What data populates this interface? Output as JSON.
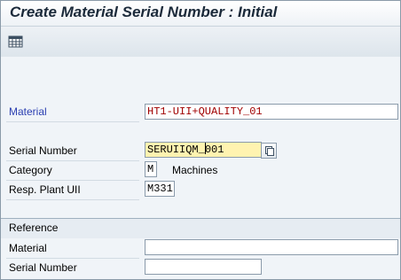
{
  "window": {
    "title": "Create Material Serial Number : Initial"
  },
  "toolbar": {
    "icons": [
      {
        "name": "grid-icon"
      }
    ]
  },
  "form": {
    "material": {
      "label": "Material",
      "value": "HT1-UII+QUALITY_01",
      "required": true
    },
    "serial_number": {
      "label": "Serial Number",
      "value_before_caret": "SERUIIQM_",
      "value_after_caret": "001"
    },
    "category": {
      "label": "Category",
      "value": "M",
      "description": "Machines"
    },
    "resp_plant_uii": {
      "label": "Resp. Plant UII",
      "value": "M331"
    }
  },
  "reference": {
    "title": "Reference",
    "material": {
      "label": "Material",
      "value": ""
    },
    "serial_number": {
      "label": "Serial Number",
      "value": ""
    }
  },
  "colors": {
    "required_label": "#2b3fb1",
    "field_text_red": "#a00000",
    "focused_field_bg": "#fff3b0",
    "background": "#f0f4f8"
  }
}
